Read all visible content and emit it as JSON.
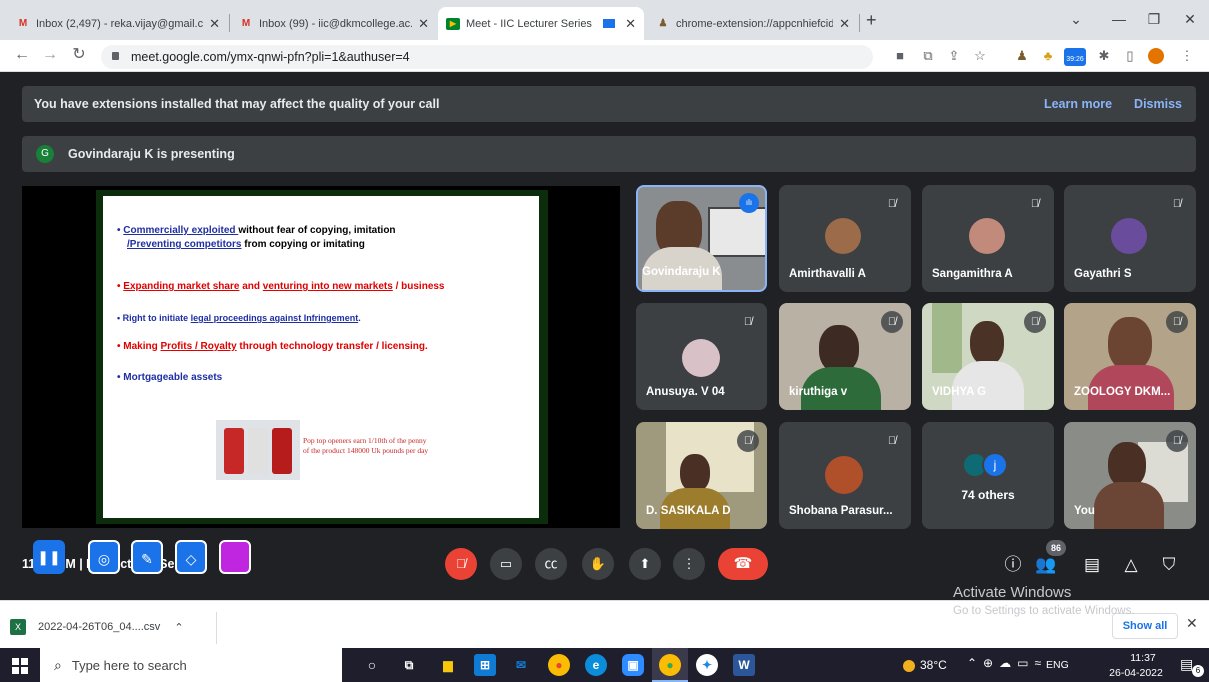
{
  "browser": {
    "tabs": [
      {
        "icon": "gmail-icon",
        "title": "Inbox (2,497) - reka.vijay@gmail.c"
      },
      {
        "icon": "gmail-icon",
        "title": "Inbox (99) - iic@dkmcollege.ac.in"
      },
      {
        "icon": "meet-icon",
        "title": "Meet - IIC Lecturer Series"
      },
      {
        "icon": "extension-icon",
        "title": "chrome-extension://appcnhiefcid"
      }
    ],
    "url": "meet.google.com/ymx-qnwi-pfn?pli=1&authuser=4",
    "timer_badge": "39:26"
  },
  "meet": {
    "ext_warning": "You have extensions installed that may affect the quality of your call",
    "learn_more": "Learn more",
    "dismiss": "Dismiss",
    "presenter_initial": "G",
    "presenting": "Govindaraju K is presenting",
    "slide": {
      "b1a": "Commercially exploited ",
      "b1b": "without fear of copying, imitation",
      "b1c": "/Preventing competitors",
      "b1d": " from copying or imitating",
      "b2a": "Expanding market share",
      "b2b": " and ",
      "b2c": "venturing into new markets",
      "b2d": " / business",
      "b3a": "Right to initiate ",
      "b3b": "legal proceedings against Infringement",
      "b3c": ".",
      "b4a": "Making ",
      "b4b": "Profits / Royalty",
      "b4c": " through technology transfer / licensing.",
      "b5": "Mortgageable assets",
      "caption1": "Pop top openers earn 1/10th of the penny",
      "caption2": "of the product 148000 Uk pounds per day"
    },
    "participants": [
      {
        "name": "Govindaraju K"
      },
      {
        "name": "Amirthavalli A"
      },
      {
        "name": "Sangamithra A"
      },
      {
        "name": "Gayathri S"
      },
      {
        "name": "Anusuya. V 04"
      },
      {
        "name": "kiruthiga v"
      },
      {
        "name": "VIDHYA G"
      },
      {
        "name": "ZOOLOGY DKM..."
      },
      {
        "name": "D. SASIKALA D"
      },
      {
        "name": "Shobana Parasur..."
      },
      {
        "name": "74 others"
      },
      {
        "name": "You"
      }
    ],
    "others_initial": "j",
    "meeting_info": "11:37 AM | IIC Lecturer Series",
    "people_count": "86",
    "activate_title": "Activate Windows",
    "activate_sub": "Go to Settings to activate Windows."
  },
  "download": {
    "file": "2022-04-26T06_04....csv",
    "show_all": "Show all"
  },
  "taskbar": {
    "search": "Type here to search",
    "weather": "38°C",
    "lang": "ENG",
    "time": "11:37",
    "date": "26-04-2022",
    "notif": "6"
  },
  "colors": {
    "accent": "#8ab4f8",
    "end_call": "#ea4335",
    "presenting_border": "#8ab4f8"
  }
}
